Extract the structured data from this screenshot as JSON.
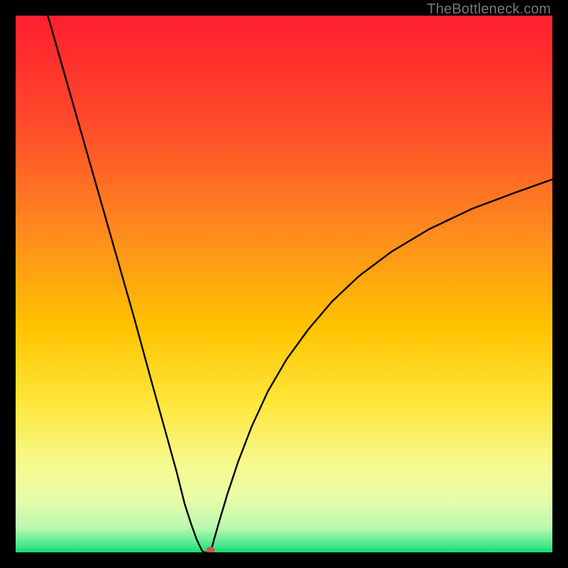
{
  "watermark": "TheBottleneck.com",
  "chart_data": {
    "type": "line",
    "title": "",
    "xlabel": "",
    "ylabel": "",
    "xlim": [
      0,
      100
    ],
    "ylim": [
      0,
      100
    ],
    "grid": false,
    "legend": false,
    "gradient_stops": [
      {
        "offset": 0.0,
        "color": "#ff1f2f"
      },
      {
        "offset": 0.2,
        "color": "#ff4a2a"
      },
      {
        "offset": 0.4,
        "color": "#ff8a1e"
      },
      {
        "offset": 0.58,
        "color": "#ffc300"
      },
      {
        "offset": 0.72,
        "color": "#ffe63a"
      },
      {
        "offset": 0.83,
        "color": "#f6f98a"
      },
      {
        "offset": 0.9,
        "color": "#e8fca8"
      },
      {
        "offset": 0.955,
        "color": "#b9f8b0"
      },
      {
        "offset": 0.985,
        "color": "#4de88e"
      },
      {
        "offset": 1.0,
        "color": "#18d973"
      }
    ],
    "series": [
      {
        "name": "left-branch",
        "x": [
          6,
          10,
          14,
          18,
          22,
          25,
          27.5,
          30,
          31.5,
          32.8,
          33.7,
          34.3,
          34.7,
          35.0
        ],
        "y": [
          100,
          86,
          72,
          58,
          44,
          33,
          24,
          15,
          9,
          5,
          2.5,
          1.2,
          0.4,
          0
        ]
      },
      {
        "name": "valley-floor",
        "x": [
          35.0,
          36.3
        ],
        "y": [
          0,
          0
        ]
      },
      {
        "name": "right-branch",
        "x": [
          36.3,
          37.0,
          38.0,
          39.5,
          41.5,
          44.0,
          47.0,
          50.5,
          54.5,
          59.0,
          64.0,
          70.0,
          77.0,
          85.0,
          93.0,
          100.0
        ],
        "y": [
          0,
          2.5,
          6.0,
          11.0,
          17.0,
          23.5,
          30.0,
          36.0,
          41.5,
          46.8,
          51.5,
          56.0,
          60.2,
          64.0,
          67.0,
          69.5
        ]
      }
    ],
    "marker": {
      "x": 36.3,
      "y": 0.4,
      "color": "#c9564b",
      "rx": 6,
      "ry": 5
    }
  }
}
